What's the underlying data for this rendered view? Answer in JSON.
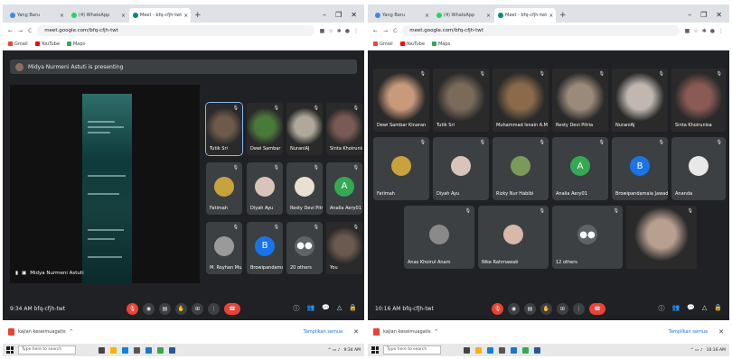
{
  "left": {
    "tabs": [
      {
        "label": "Yang Baru",
        "color": "#4285f4"
      },
      {
        "label": "(4) WhatsApp",
        "color": "#25d366"
      },
      {
        "label": "Meet - bfq-cfjh-twt",
        "color": "#00897b"
      }
    ],
    "url": "meet.google.com/bfq-cfjh-twt",
    "bookmarks": [
      {
        "label": "Gmail",
        "color": "#ea4335"
      },
      {
        "label": "YouTube",
        "color": "#ff0000"
      },
      {
        "label": "Maps",
        "color": "#34a853"
      }
    ],
    "presenting_text": "Midya Nurmeni Astuti is presenting",
    "presenter_name": "Midya Nurmeni Astuti",
    "tiles": [
      {
        "name": "Tutik Sri",
        "type": "cam",
        "color": "#6d5a4a"
      },
      {
        "name": "Dewi Sambar",
        "type": "cam",
        "color": "#4a7a3a"
      },
      {
        "name": "NuraniAJ",
        "type": "cam",
        "color": "#b0a89a"
      },
      {
        "name": "Sinta Khoirunisa",
        "type": "cam",
        "color": "#7a5a55"
      },
      {
        "name": "Fatimah",
        "type": "avatar",
        "color": "#c8a23c",
        "letter": ""
      },
      {
        "name": "Diyah Ayu",
        "type": "avatar",
        "color": "#d8c4b8",
        "letter": ""
      },
      {
        "name": "Resty Devi Pitria",
        "type": "avatar",
        "color": "#e8e0d0",
        "letter": ""
      },
      {
        "name": "Analia Aery01",
        "type": "avatar",
        "color": "#34a853",
        "letter": "A"
      },
      {
        "name": "M. Royhan Mu...",
        "type": "avatar",
        "color": "#9a9a9a",
        "letter": ""
      },
      {
        "name": "Browipandama...",
        "type": "avatar",
        "color": "#1a73e8",
        "letter": "B"
      },
      {
        "name": "20 others",
        "type": "avatar",
        "color": "#5f6368",
        "letter": "●●"
      },
      {
        "name": "You",
        "type": "cam",
        "color": "#6a5a50"
      }
    ],
    "clock": "9:34 AM  bfq-cfjh-twt",
    "download_file": "kajian keseimuagatis",
    "show_all": "Tampilkan semua",
    "search_placeholder": "Type here to search",
    "tray_time": "9:34 AM"
  },
  "right": {
    "tabs": [
      {
        "label": "Yang Baru",
        "color": "#4285f4"
      },
      {
        "label": "(4) WhatsApp",
        "color": "#25d366"
      },
      {
        "label": "Meet - bfq-cfjh-twt",
        "color": "#00897b"
      }
    ],
    "url": "meet.google.com/bfq-cfjh-twt",
    "bookmarks": [
      {
        "label": "Gmail",
        "color": "#ea4335"
      },
      {
        "label": "YouTube",
        "color": "#ff0000"
      },
      {
        "label": "Maps",
        "color": "#34a853"
      }
    ],
    "tiles": [
      {
        "name": "Dewi Sambar Kinaran",
        "type": "cam",
        "color": "#c89a7a"
      },
      {
        "name": "Tutik Sri",
        "type": "cam",
        "color": "#7a6a5a"
      },
      {
        "name": "Muhammad Isnain A.M",
        "type": "cam",
        "color": "#8a6a4a"
      },
      {
        "name": "Resty Devi Pitria",
        "type": "cam",
        "color": "#9a8a7a"
      },
      {
        "name": "NuraniAJ",
        "type": "cam",
        "color": "#c0b8b0"
      },
      {
        "name": "Sinta Khoirunisa",
        "type": "cam",
        "color": "#8a5a55"
      },
      {
        "name": "Fatimah",
        "type": "avatar",
        "color": "#c8a23c",
        "letter": ""
      },
      {
        "name": "Diyah Ayu",
        "type": "avatar",
        "color": "#d8c4b8",
        "letter": ""
      },
      {
        "name": "Rizky Nur Habibi",
        "type": "avatar",
        "color": "#7a9a5a",
        "letter": ""
      },
      {
        "name": "Analia Aery01",
        "type": "avatar",
        "color": "#34a853",
        "letter": "A"
      },
      {
        "name": "Browipandamaia Jawad...",
        "type": "avatar",
        "color": "#1a73e8",
        "letter": "B"
      },
      {
        "name": "Ananda",
        "type": "avatar",
        "color": "#e8e8e8",
        "letter": ""
      },
      {
        "name": "Anas Khoirul Anam",
        "type": "avatar",
        "color": "#8a8a8a",
        "letter": ""
      },
      {
        "name": "Nike Rahmawati",
        "type": "avatar",
        "color": "#d8b8a8",
        "letter": ""
      },
      {
        "name": "12 others",
        "type": "avatar",
        "color": "#5f6368",
        "letter": "●●"
      },
      {
        "name": "",
        "type": "cam",
        "color": "#b8a090"
      }
    ],
    "clock": "10:16 AM  bfq-cfjh-twt",
    "download_file": "kajian keseimuagatis",
    "show_all": "Tampilkan semua",
    "search_placeholder": "Type here to search",
    "tray_time": "10:16 AM"
  }
}
